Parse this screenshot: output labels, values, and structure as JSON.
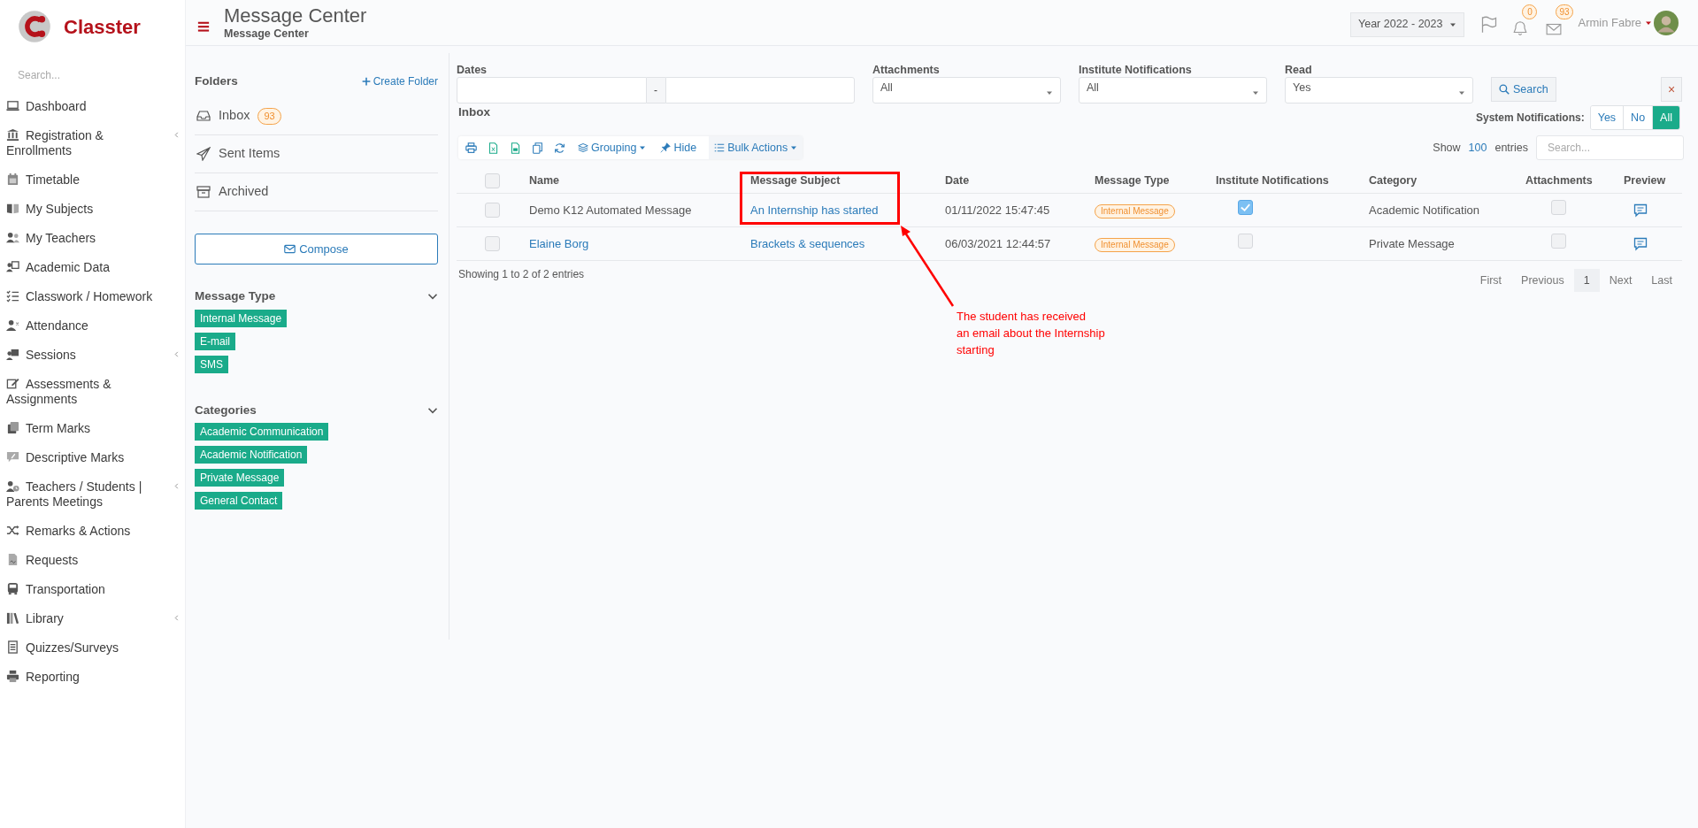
{
  "brand": {
    "name": "Classter"
  },
  "sidebar": {
    "search_placeholder": "Search...",
    "items": [
      {
        "label": "Dashboard",
        "has_submenu": false
      },
      {
        "label": "Registration & Enrollments",
        "has_submenu": true
      },
      {
        "label": "Timetable",
        "has_submenu": false
      },
      {
        "label": "My Subjects",
        "has_submenu": false
      },
      {
        "label": "My Teachers",
        "has_submenu": false
      },
      {
        "label": "Academic Data",
        "has_submenu": false
      },
      {
        "label": "Classwork / Homework",
        "has_submenu": false
      },
      {
        "label": "Attendance",
        "has_submenu": false
      },
      {
        "label": "Sessions",
        "has_submenu": true
      },
      {
        "label": "Assessments & Assignments",
        "has_submenu": false
      },
      {
        "label": "Term Marks",
        "has_submenu": false
      },
      {
        "label": "Descriptive Marks",
        "has_submenu": false
      },
      {
        "label": "Teachers / Students | Parents Meetings",
        "has_submenu": true
      },
      {
        "label": "Remarks & Actions",
        "has_submenu": false
      },
      {
        "label": "Requests",
        "has_submenu": false
      },
      {
        "label": "Transportation",
        "has_submenu": false
      },
      {
        "label": "Library",
        "has_submenu": true
      },
      {
        "label": "Quizzes/Surveys",
        "has_submenu": false
      },
      {
        "label": "Reporting",
        "has_submenu": false
      }
    ]
  },
  "header": {
    "title": "Message Center",
    "subtitle": "Message Center",
    "year": "Year 2022 - 2023",
    "notifications_count": "0",
    "messages_count": "93",
    "user": "Armin Fabre"
  },
  "folders": {
    "title": "Folders",
    "create_label": "Create Folder",
    "items": [
      {
        "label": "Inbox",
        "count": "93"
      },
      {
        "label": "Sent Items"
      },
      {
        "label": "Archived"
      }
    ],
    "compose": "Compose",
    "sections": [
      {
        "title": "Message Type",
        "expanded": true,
        "tags": [
          "Internal Message",
          "E-mail",
          "SMS"
        ]
      },
      {
        "title": "Categories",
        "expanded": true,
        "tags": [
          "Academic Communication",
          "Academic Notification",
          "Private Message",
          "General Contact"
        ]
      }
    ]
  },
  "filters": {
    "dates_label": "Dates",
    "dates_separator": "-",
    "selects": [
      {
        "label": "Attachments",
        "value": "All"
      },
      {
        "label": "Institute Notifications",
        "value": "All"
      },
      {
        "label": "Read",
        "value": "Yes"
      }
    ],
    "search_button": "Search",
    "clear_button": "×",
    "system_notifications": {
      "label": "System Notifications:",
      "options": [
        {
          "label": "Yes",
          "selected": false
        },
        {
          "label": "No",
          "selected": false
        },
        {
          "label": "All",
          "selected": true
        }
      ]
    }
  },
  "inbox": {
    "title": "Inbox",
    "all_selected": false,
    "toolbar": [
      "Grouping",
      "Hide",
      "Bulk Actions"
    ],
    "show_label": "Show",
    "page_size": "100",
    "entries_label": "entries",
    "search_placeholder": "Search...",
    "columns": [
      "Name",
      "Message Subject",
      "Date",
      "Message Type",
      "Institute Notifications",
      "Category",
      "Attachments",
      "Preview"
    ],
    "rows": [
      {
        "selected": false,
        "name": "Demo K12 Automated Message",
        "name_is_link": false,
        "subject": "An Internship has started",
        "date": "01/11/2022 15:47:45",
        "type": "Internal Message",
        "institute_notification": true,
        "category": "Academic Notification",
        "attachment": false
      },
      {
        "selected": false,
        "name": "Elaine Borg",
        "name_is_link": true,
        "subject": "Brackets & sequences",
        "date": "06/03/2021 12:44:57",
        "type": "Internal Message",
        "institute_notification": false,
        "category": "Private Message",
        "attachment": false
      }
    ],
    "summary": "Showing 1 to 2 of 2 entries",
    "pagination": [
      {
        "label": "First",
        "selected": false
      },
      {
        "label": "Previous",
        "selected": false
      },
      {
        "label": "1",
        "selected": true
      },
      {
        "label": "Next",
        "selected": false
      },
      {
        "label": "Last",
        "selected": false
      }
    ]
  },
  "annotation": {
    "lines": [
      "The student has received",
      "an email about the Internship",
      "starting"
    ]
  }
}
